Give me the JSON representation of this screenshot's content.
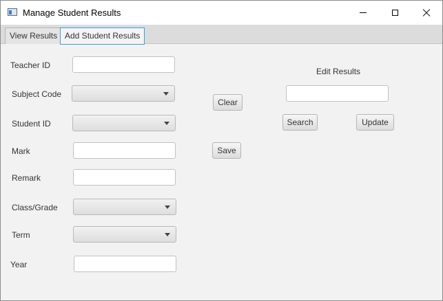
{
  "window": {
    "title": "Manage Student Results",
    "icon": "app-window-icon",
    "controls": [
      "minimize-icon",
      "maximize-icon",
      "close-icon"
    ]
  },
  "tabs": [
    {
      "label": "View Results",
      "active": false
    },
    {
      "label": "Add Student Results",
      "active": true
    }
  ],
  "form": {
    "teacher_id_label": "Teacher ID",
    "teacher_id_value": "",
    "subject_code_label": "Subject Code",
    "subject_code_value": "",
    "student_id_label": "Student ID",
    "student_id_value": "",
    "mark_label": "Mark",
    "mark_value": "",
    "remark_label": "Remark",
    "remark_value": "",
    "class_grade_label": "Class/Grade",
    "class_grade_value": "",
    "term_label": "Term",
    "term_value": "",
    "year_label": "Year",
    "year_value": ""
  },
  "actions": {
    "clear_label": "Clear",
    "save_label": "Save"
  },
  "edit": {
    "heading": "Edit Results",
    "search_value": "",
    "search_label": "Search",
    "update_label": "Update"
  }
}
